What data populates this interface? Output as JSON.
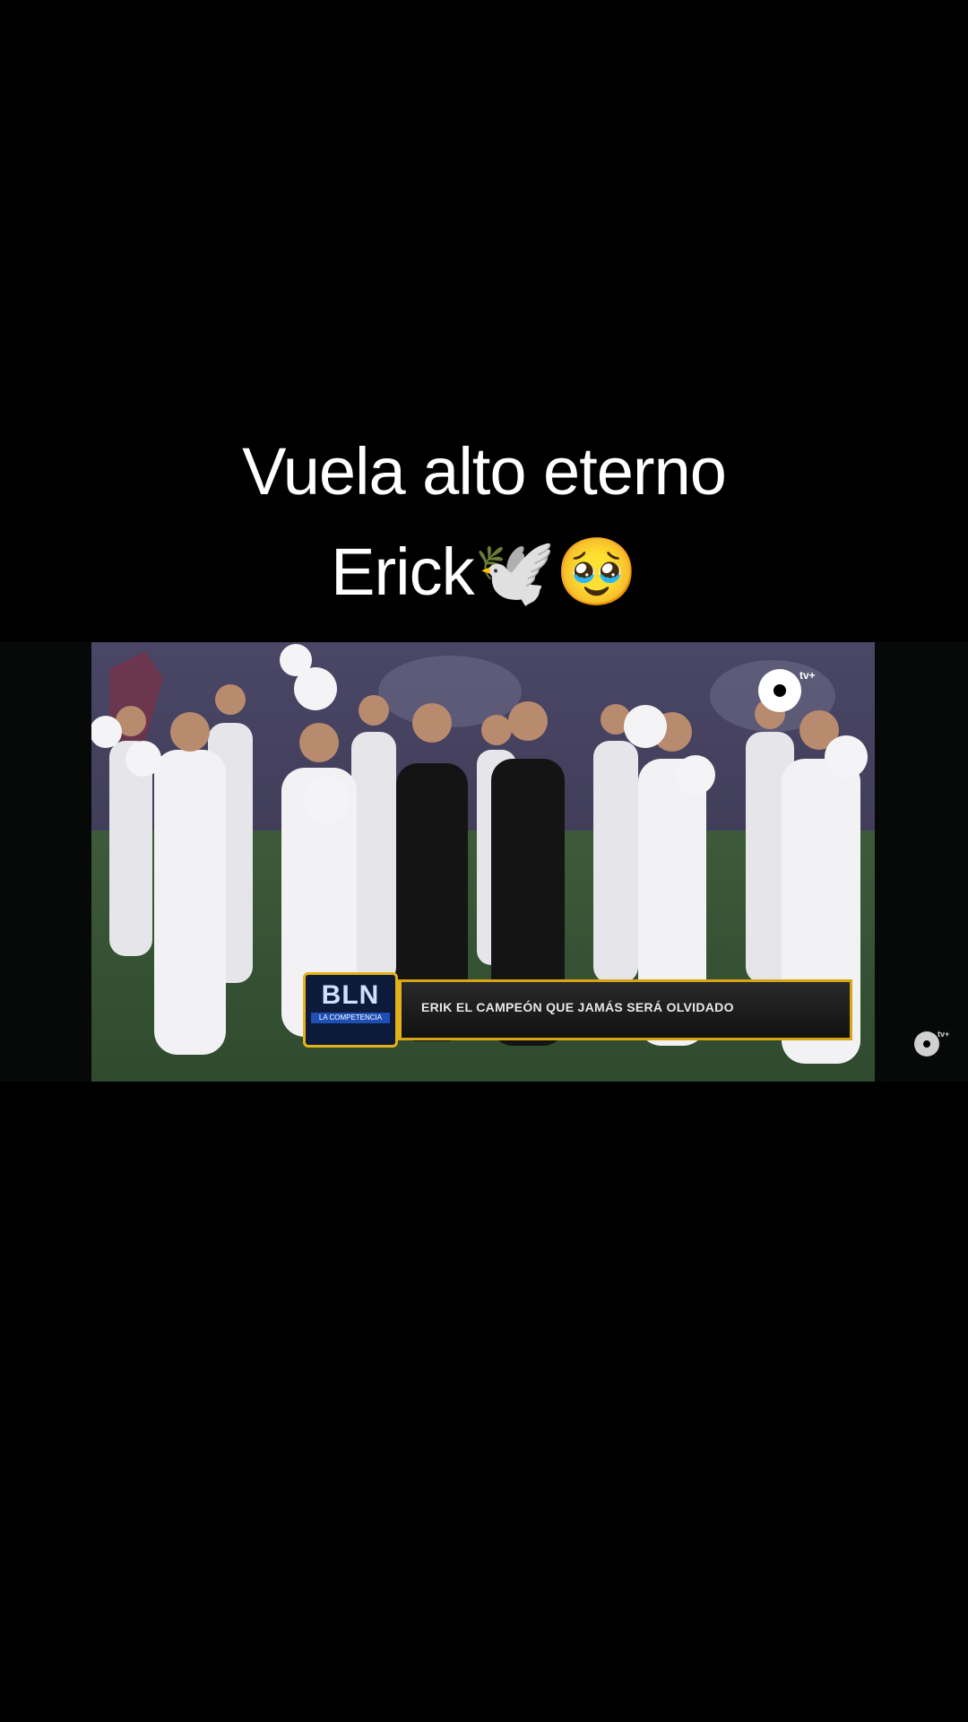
{
  "caption": {
    "line1": "Vuela alto eterno",
    "line2": "Erick🕊️🥹"
  },
  "broadcast": {
    "show_logo": "BLN",
    "show_logo_sub": "LA COMPETENCIA",
    "lower_third": "ERIK EL CAMPEÓN QUE JAMÁS SERÁ OLVIDADO",
    "channel_logo_suffix": "tv+",
    "watermark_suffix": "tv+"
  },
  "colors": {
    "background": "#000000",
    "caption_text": "#ffffff",
    "lower_third_border": "#e3b21a"
  }
}
